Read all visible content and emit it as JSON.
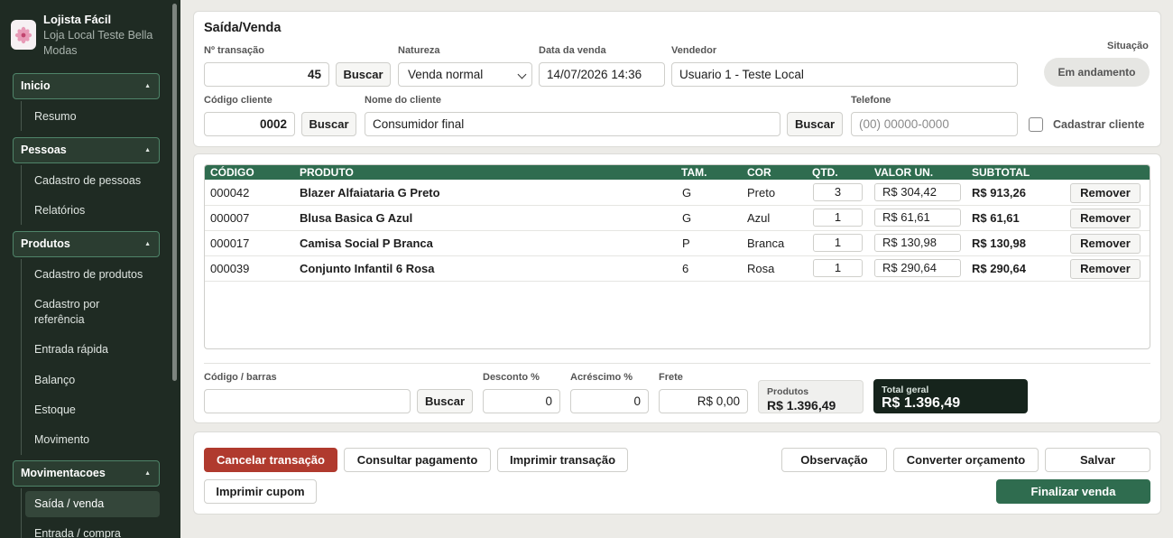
{
  "sidebar": {
    "app_title": "Lojista Fácil",
    "store_name": "Loja Local Teste Bella Modas",
    "groups": [
      {
        "label": "Inicio",
        "items": [
          "Resumo"
        ]
      },
      {
        "label": "Pessoas",
        "items": [
          "Cadastro de pessoas",
          "Relatórios"
        ]
      },
      {
        "label": "Produtos",
        "items": [
          "Cadastro de produtos",
          "Cadastro por referência",
          "Entrada rápida",
          "Balanço",
          "Estoque",
          "Movimento"
        ]
      },
      {
        "label": "Movimentacoes",
        "items": [
          "Saída / venda",
          "Entrada / compra"
        ]
      }
    ],
    "active_item": "Saída / venda"
  },
  "header": {
    "title": "Saída/Venda",
    "transaction_label": "Nº transação",
    "transaction_value": "45",
    "search_label": "Buscar",
    "nature_label": "Natureza",
    "nature_value": "Venda normal",
    "date_label": "Data da venda",
    "date_value": "14/07/2026 14:36",
    "seller_label": "Vendedor",
    "seller_value": "Usuario 1 - Teste Local",
    "status_label": "Situação",
    "status_value": "Em andamento",
    "client_code_label": "Código cliente",
    "client_code_value": "0002",
    "client_name_label": "Nome do cliente",
    "client_name_value": "Consumidor final",
    "phone_label": "Telefone",
    "phone_placeholder": "(00) 00000-0000",
    "register_client_label": "Cadastrar cliente"
  },
  "table": {
    "columns": [
      "CÓDIGO",
      "PRODUTO",
      "TAM.",
      "COR",
      "QTD.",
      "VALOR UN.",
      "SUBTOTAL"
    ],
    "rows": [
      {
        "code": "000042",
        "product": "Blazer Alfaiataria G Preto",
        "size": "G",
        "color": "Preto",
        "qty": "3",
        "unit": "R$ 304,42",
        "subtotal": "R$ 913,26"
      },
      {
        "code": "000007",
        "product": "Blusa Basica G Azul",
        "size": "G",
        "color": "Azul",
        "qty": "1",
        "unit": "R$ 61,61",
        "subtotal": "R$ 61,61"
      },
      {
        "code": "000017",
        "product": "Camisa Social P Branca",
        "size": "P",
        "color": "Branca",
        "qty": "1",
        "unit": "R$ 130,98",
        "subtotal": "R$ 130,98"
      },
      {
        "code": "000039",
        "product": "Conjunto Infantil 6 Rosa",
        "size": "6",
        "color": "Rosa",
        "qty": "1",
        "unit": "R$ 290,64",
        "subtotal": "R$ 290,64"
      }
    ],
    "remove_label": "Remover"
  },
  "footer": {
    "barcode_label": "Código / barras",
    "barcode_value": "",
    "search_label": "Buscar",
    "discount_label": "Desconto %",
    "discount_value": "0",
    "surcharge_label": "Acréscimo %",
    "surcharge_value": "0",
    "freight_label": "Frete",
    "freight_value": "R$ 0,00",
    "products_label": "Produtos",
    "products_value": "R$ 1.396,49",
    "total_label": "Total geral",
    "total_value": "R$ 1.396,49"
  },
  "actions": {
    "cancel": "Cancelar transação",
    "check_payment": "Consultar pagamento",
    "print_transaction": "Imprimir transação",
    "print_receipt": "Imprimir cupom",
    "note": "Observação",
    "convert_quote": "Converter orçamento",
    "save": "Salvar",
    "finish_sale": "Finalizar venda"
  },
  "colors": {
    "sidebar_bg": "#1f2b23",
    "accent_green": "#2f6c4f",
    "cancel_red": "#b03a2e",
    "total_dark": "#16241c"
  }
}
